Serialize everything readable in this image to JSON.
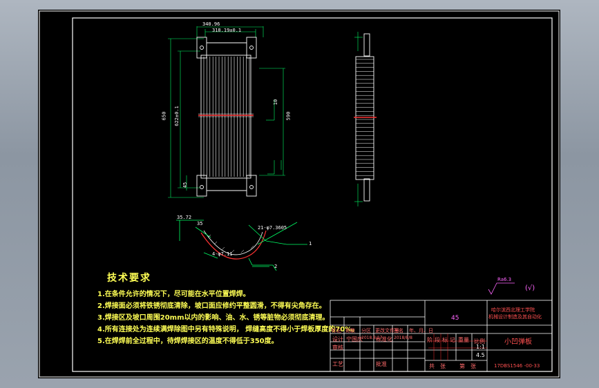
{
  "drawing": {
    "background": "#000000",
    "frame_color": "#ffffff",
    "line_color": "#ffffff",
    "dim_color": "#00ff66",
    "accent_color": "#ff3333",
    "text_color": "#ffff55"
  },
  "dimensions": {
    "top_width": "340.96",
    "top_inner": "318.19±0.1",
    "total_height": "650",
    "inner_height": "622±0.1",
    "right_height": "590",
    "left_small": "45",
    "right_small": "10",
    "section_a": "35.72",
    "section_b": "35",
    "section_c": "4-φ7.11",
    "section_d": "21-φ7.3605",
    "leader_1": "1",
    "leader_2": "2"
  },
  "tech_requirements": {
    "title": "技术要求",
    "items": [
      "1.在条件允许的情况下，尽可能在水平位置焊焊。",
      "2.焊接面必须将铁锈彻底清除，坡口面应修约平整圆滑，不得有尖角存在。",
      "3.焊接区及坡口周围20mm以内的影响、油、水、锈等脏物必须彻底清理。",
      "4.所有连接处为连续满焊除图中另有特殊说明， 焊缝高度不得小于焊板厚度的70%。",
      "5.在焊焊前全过程中，待焊焊接区的温度不得低于350度。"
    ]
  },
  "surface_finish": {
    "symbol": "Ra6.3",
    "note": "(√)"
  },
  "title_block": {
    "material": "45",
    "institution_line1": "哈尔滨西北理工学院",
    "institution_line2": "机械设计制造及其自动化",
    "part_name": "小凹弹板",
    "drawing_number": "17DBS1546 -00-33",
    "scale": "1:1",
    "scale_label": "比例",
    "ratio_value": "4.5",
    "row_labels": [
      "标记",
      "处数",
      "分区",
      "更改文件号",
      "签名",
      "年、月、日"
    ],
    "design_label": "设计",
    "designer": "宁国庆",
    "date": "2018.8.17",
    "std_label": "标准化",
    "std_value": "2018/8/8",
    "check_label": "审核",
    "process_label": "工艺",
    "approve_label": "批准",
    "stage_labels": [
      "阶",
      "段",
      "标",
      "记",
      "重量"
    ],
    "sheet_labels": [
      "共",
      "张",
      "第",
      "张"
    ]
  }
}
